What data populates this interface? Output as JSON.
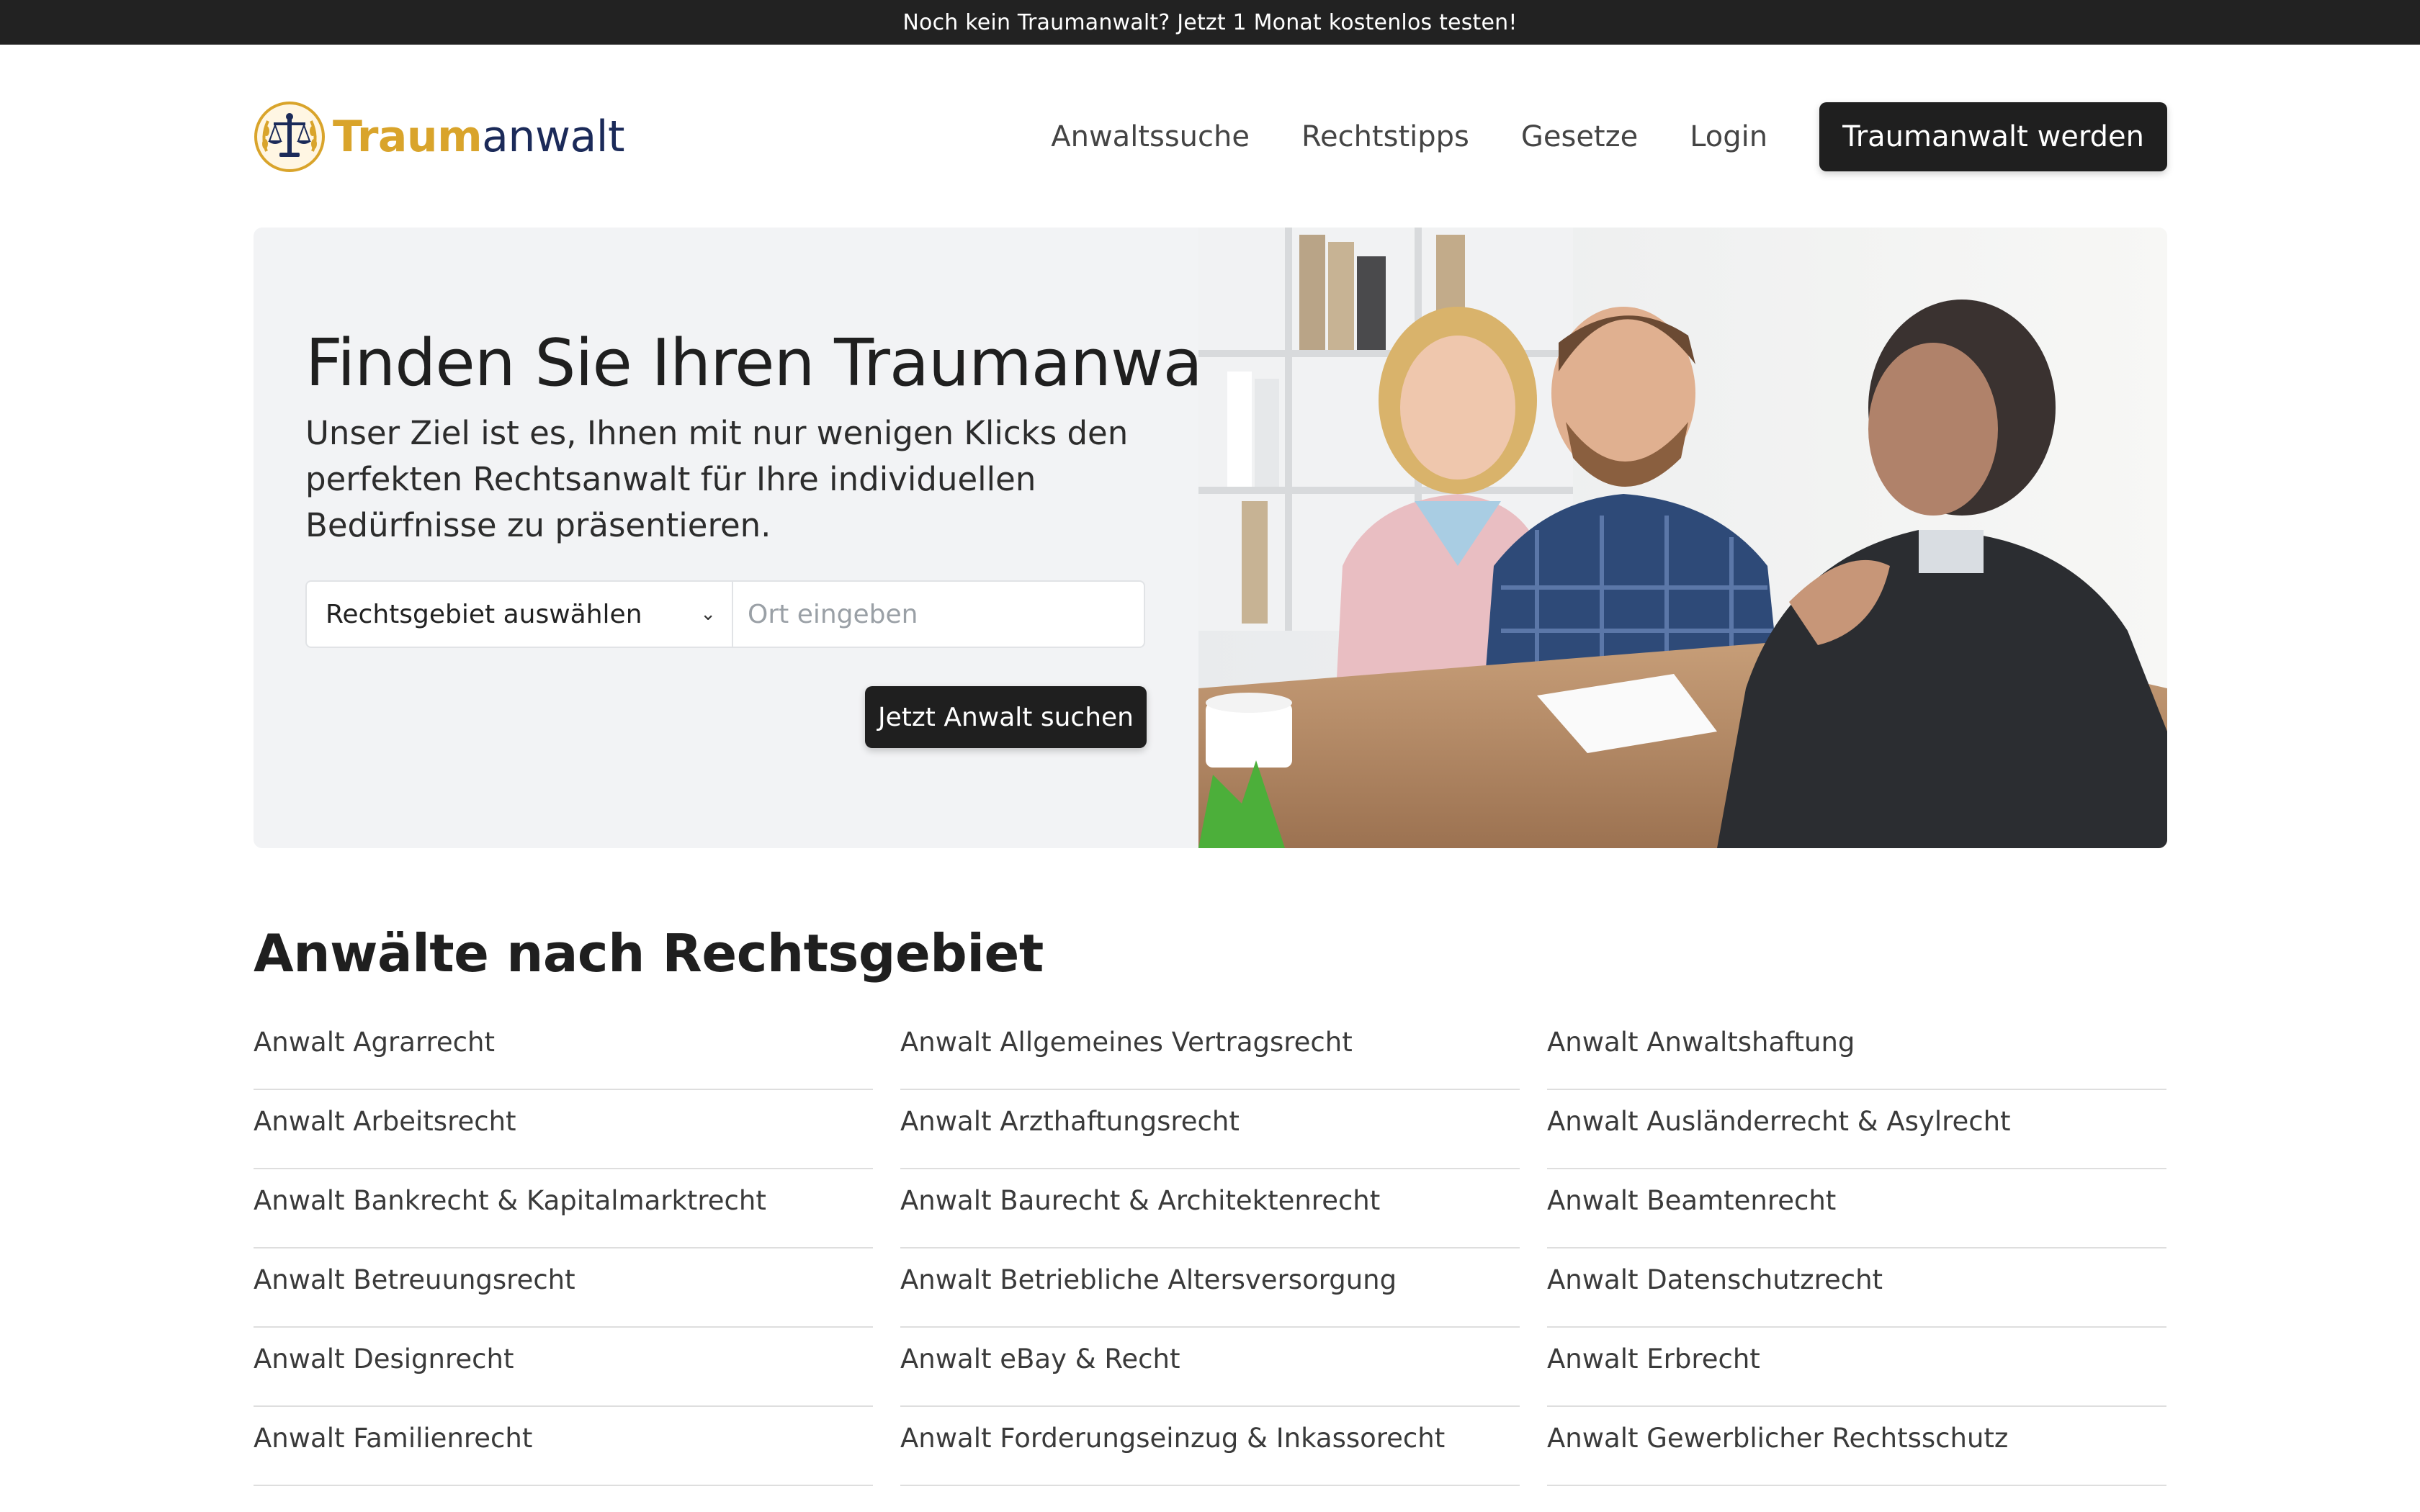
{
  "topbar": {
    "text": "Noch kein Traumanwalt? Jetzt 1 Monat kostenlos testen!"
  },
  "logo": {
    "part1": "Traum",
    "part2": "anwalt",
    "icon": "scales-of-justice-icon"
  },
  "nav": {
    "links": [
      "Anwaltssuche",
      "Rechtstipps",
      "Gesetze",
      "Login"
    ],
    "cta": "Traumanwalt werden"
  },
  "hero": {
    "title": "Finden Sie Ihren Traumanwalt",
    "subtitle": "Unser Ziel ist es, Ihnen mit nur wenigen Klicks den perfekten Rechtsanwalt für Ihre individuellen Bedürfnisse zu präsentieren.",
    "select_value": "Rechtsgebiet auswählen",
    "input_placeholder": "Ort eingeben",
    "button": "Jetzt Anwalt suchen"
  },
  "section": {
    "title": "Anwälte nach Rechtsgebiet",
    "items": [
      "Anwalt Agrarrecht",
      "Anwalt Allgemeines Vertragsrecht",
      "Anwalt Anwaltshaftung",
      "Anwalt Arbeitsrecht",
      "Anwalt Arzthaftungsrecht",
      "Anwalt Ausländerrecht & Asylrecht",
      "Anwalt Bankrecht & Kapitalmarktrecht",
      "Anwalt Baurecht & Architektenrecht",
      "Anwalt Beamtenrecht",
      "Anwalt Betreuungsrecht",
      "Anwalt Betriebliche Altersversorgung",
      "Anwalt Datenschutzrecht",
      "Anwalt Designrecht",
      "Anwalt eBay & Recht",
      "Anwalt Erbrecht",
      "Anwalt Familienrecht",
      "Anwalt Forderungseinzug & Inkassorecht",
      "Anwalt Gewerblicher Rechtsschutz"
    ]
  },
  "colors": {
    "brand_gold": "#d9a42b",
    "brand_navy": "#1b2a59",
    "dark": "#1f1f1f"
  }
}
